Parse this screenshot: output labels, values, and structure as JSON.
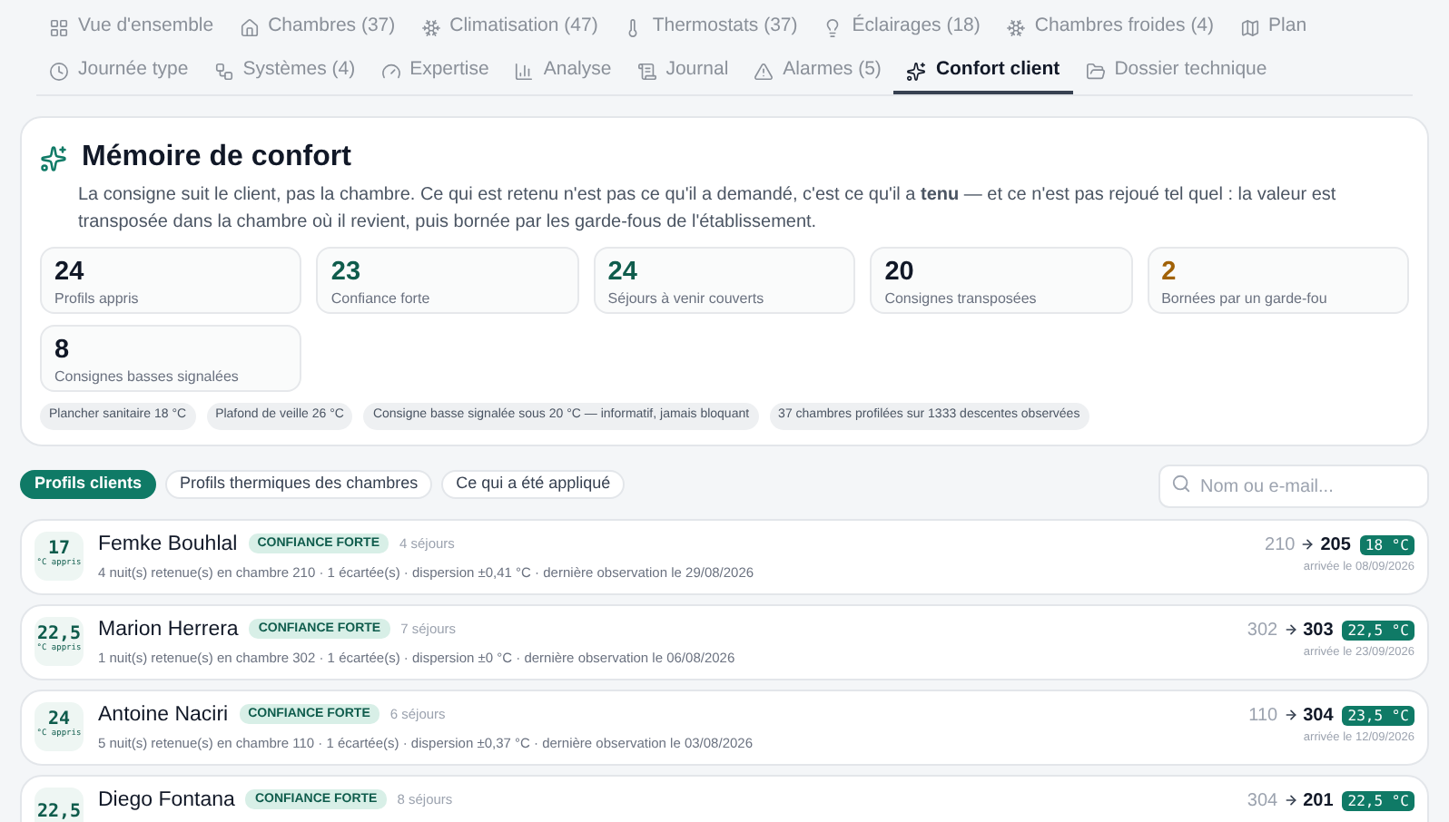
{
  "tabs": [
    {
      "label": "Vue d'ensemble",
      "selected": false
    },
    {
      "label": "Chambres (37)",
      "selected": false
    },
    {
      "label": "Climatisation (47)",
      "selected": false
    },
    {
      "label": "Thermostats (37)",
      "selected": false
    },
    {
      "label": "Éclairages (18)",
      "selected": false
    },
    {
      "label": "Chambres froides (4)",
      "selected": false
    },
    {
      "label": "Plan",
      "selected": false
    },
    {
      "label": "Journée type",
      "selected": false
    },
    {
      "label": "Systèmes (4)",
      "selected": false
    },
    {
      "label": "Expertise",
      "selected": false
    },
    {
      "label": "Analyse",
      "selected": false
    },
    {
      "label": "Journal",
      "selected": false
    },
    {
      "label": "Alarmes (5)",
      "selected": false
    },
    {
      "label": "Confort client",
      "selected": true
    },
    {
      "label": "Dossier technique",
      "selected": false
    }
  ],
  "memory": {
    "title": "Mémoire de confort",
    "description": "La consigne suit le client, pas la chambre. Ce qui est retenu n'est pas ce qu'il a demandé, c'est ce qu'il a **tenu** — et ce n'est pas rejoué tel quel : la valeur est transposée dans la chambre où il revient, puis bornée par les garde-fous de l'établissement.",
    "stats": [
      {
        "value": "24",
        "label": "Profils appris",
        "kind": "default"
      },
      {
        "value": "23",
        "label": "Confiance forte",
        "kind": "good"
      },
      {
        "value": "24",
        "label": "Séjours à venir couverts",
        "kind": "good"
      },
      {
        "value": "20",
        "label": "Consignes transposées",
        "kind": "default"
      },
      {
        "value": "2",
        "label": "Bornées par un garde-fou",
        "kind": "warn"
      },
      {
        "value": "8",
        "label": "Consignes basses signalées",
        "kind": "default"
      }
    ],
    "chips": [
      "Plancher sanitaire 18 °C",
      "Plafond de veille 26 °C",
      "Consigne basse signalée sous 20 °C — informatif, jamais bloquant",
      "37 chambres profilées sur 1333 descentes observées"
    ]
  },
  "filters": [
    {
      "label": "Profils clients",
      "selected": true
    },
    {
      "label": "Profils thermiques des chambres",
      "selected": false
    },
    {
      "label": "Ce qui a été appliqué",
      "selected": false
    }
  ],
  "search": {
    "placeholder": "Nom ou e-mail..."
  },
  "clients": [
    {
      "learned": "17",
      "learned_unit": "°C appris",
      "name": "Femke Bouhlal",
      "badge": "CONFIANCE FORTE",
      "stays": "4 séjours",
      "detail": "4 nuit(s) retenue(s) en chambre 210 · 1 écartée(s) · dispersion ±0,41 °C · dernière observation le 29/08/2026",
      "from_room": "210",
      "to_room": "205",
      "setpoint": "18 °C",
      "arrival": "arrivée le 08/09/2026"
    },
    {
      "learned": "22,5",
      "learned_unit": "°C appris",
      "name": "Marion Herrera",
      "badge": "CONFIANCE FORTE",
      "stays": "7 séjours",
      "detail": "1 nuit(s) retenue(s) en chambre 302 · 1 écartée(s) · dispersion ±0 °C · dernière observation le 06/08/2026",
      "from_room": "302",
      "to_room": "303",
      "setpoint": "22,5 °C",
      "arrival": "arrivée le 23/09/2026"
    },
    {
      "learned": "24",
      "learned_unit": "°C appris",
      "name": "Antoine Naciri",
      "badge": "CONFIANCE FORTE",
      "stays": "6 séjours",
      "detail": "5 nuit(s) retenue(s) en chambre 110 · 1 écartée(s) · dispersion ±0,37 °C · dernière observation le 03/08/2026",
      "from_room": "110",
      "to_room": "304",
      "setpoint": "23,5 °C",
      "arrival": "arrivée le 12/09/2026"
    },
    {
      "learned": "22,5",
      "name": "Diego Fontana",
      "badge": "CONFIANCE FORTE",
      "stays": "8 séjours",
      "from_room": "304",
      "to_room": "201",
      "setpoint": "22,5 °C"
    }
  ]
}
